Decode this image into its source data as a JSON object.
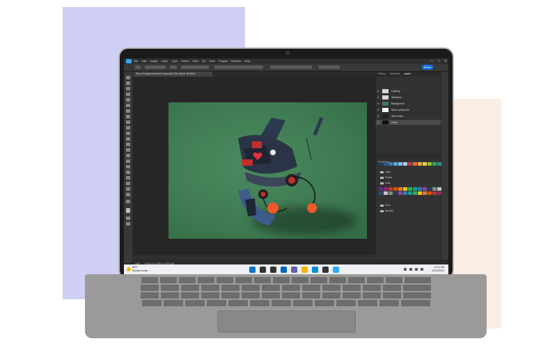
{
  "app": {
    "doc_tab": "Shoe Orange Balanced Layout@ 33% (Multi. RGB/8*)",
    "share_label": "Share",
    "menu": [
      "File",
      "Edit",
      "Image",
      "Layer",
      "Type",
      "Select",
      "Filter",
      "3D",
      "View",
      "Plugins",
      "Window",
      "Help"
    ],
    "window_controls": [
      "—",
      "□",
      "✕"
    ]
  },
  "panels": {
    "tabs": [
      "History",
      "Channels",
      "Layers"
    ],
    "layers": [
      {
        "name": "Lighting"
      },
      {
        "name": "Shadows"
      },
      {
        "name": "Background"
      },
      {
        "name": "Shoe composite"
      },
      {
        "name": "Shoe base"
      },
      {
        "name": "Mask"
      }
    ],
    "swatches_title": "Swatches",
    "swatch_folders": [
      "Light",
      "Pastel",
      "Dark",
      "Pure",
      "Neutral"
    ],
    "swatch_colors_row1": [
      "#1f3c5a",
      "#2d5a87",
      "#3a7fb8",
      "#5aa6d6",
      "#7fc2e6",
      "#a7d6ef",
      "#c33a3a",
      "#e86c3a",
      "#f4a83a",
      "#f6d23a",
      "#8dc63f",
      "#3aa655",
      "#2f8f8f",
      "#5c5caf"
    ],
    "swatch_colors_dark": [
      "#5a2a8a",
      "#8a2a6a",
      "#c0392b",
      "#d35400",
      "#e67e22",
      "#f1c40f",
      "#27ae60",
      "#16a085",
      "#2980b9",
      "#8e44ad",
      "#2c3e50",
      "#7f8c8d",
      "#bdc3c7",
      "#34495e"
    ]
  },
  "status": {
    "zoom": "33%",
    "size": "5740 px x 3230 px (300 ppi)"
  },
  "taskbar": {
    "weather_temp": "68°F",
    "weather_desc": "Mostly cloudy",
    "time": "11:11 AM",
    "date": "10/24/2022",
    "apps": [
      "start",
      "search",
      "task-view",
      "widgets",
      "teams-chat",
      "file-explorer",
      "edge",
      "store",
      "photoshop"
    ],
    "app_colors": [
      "#0078d4",
      "#333333",
      "#333333",
      "#0067c0",
      "#6264a7",
      "#f2b705",
      "#0c8bd6",
      "#333333",
      "#31a8ff"
    ]
  },
  "colors": {
    "artboard": "#3e7b52",
    "accent": "#31a8ff",
    "share": "#1473e6",
    "bg_blue": "#cfd0f4",
    "bg_peach": "#fbeee4"
  }
}
